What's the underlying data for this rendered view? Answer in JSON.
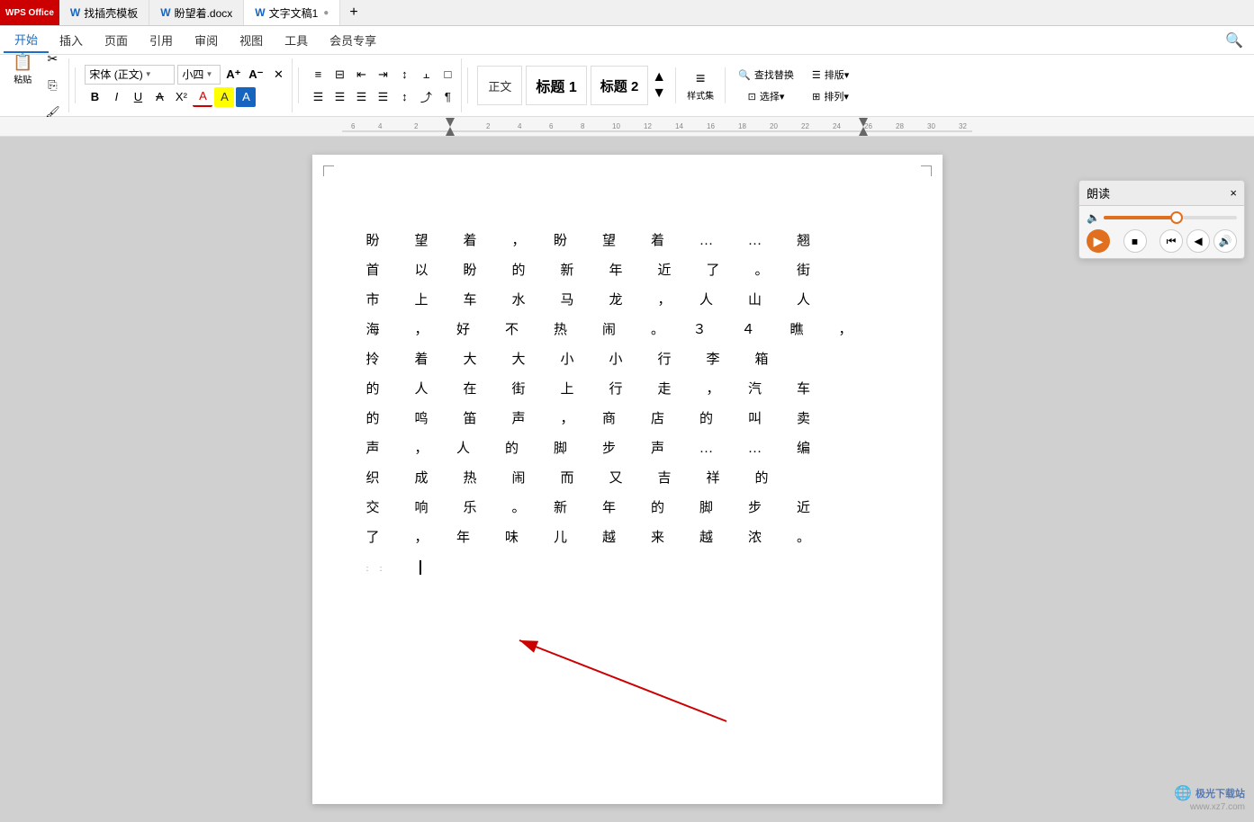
{
  "titlebar": {
    "logo": "WPS Office",
    "tabs": [
      {
        "label": "找插壳模板",
        "icon": "W",
        "active": false
      },
      {
        "label": "盼望着.docx",
        "icon": "W",
        "active": false
      },
      {
        "label": "文字文稿1",
        "icon": "W",
        "active": true
      }
    ],
    "new_tab": "+"
  },
  "ribbon": {
    "tabs": [
      {
        "label": "开始",
        "active": true
      },
      {
        "label": "插入",
        "active": false
      },
      {
        "label": "页面",
        "active": false
      },
      {
        "label": "引用",
        "active": false
      },
      {
        "label": "审阅",
        "active": false
      },
      {
        "label": "视图",
        "active": false
      },
      {
        "label": "工具",
        "active": false
      },
      {
        "label": "会员专享",
        "active": false
      }
    ],
    "font": {
      "name": "宋体 (正文)",
      "size": "小四"
    },
    "style_buttons": [
      {
        "label": "正文",
        "class": "zhengwen"
      },
      {
        "label": "标题 1",
        "class": "biaoti1"
      },
      {
        "label": "标题 2",
        "class": "biaoti2"
      }
    ],
    "right_buttons": [
      {
        "label": "样式集",
        "icon": "≡"
      },
      {
        "label": "查找替换",
        "icon": "🔍"
      },
      {
        "label": "选择▾",
        "icon": "⊡"
      },
      {
        "label": "排版▾",
        "icon": "☰"
      },
      {
        "label": "排列▾",
        "icon": "⊞"
      }
    ]
  },
  "doc": {
    "content_lines": [
      "盼　望　着　，　盼　望　着　…　…　翘",
      "首　以　盼　的　新　年　近　了　。　街",
      "市　上　车　水　马　龙　，　人　山　人",
      "海　，　好　不　热　闹　。　３　４　瞧　，",
      "拎　着　大　大　小　小　行　李　箱",
      "的　人　在　街　上　行　走　，　汽　车",
      "的　鸣　笛　声　，　商　店　的　叫　卖",
      "声　，　人　的　脚　步　声　…　…　编",
      "织　成　热　闹　而　又　吉　祥　的",
      "交　响　乐　。　新　年　的　脚　步　近",
      "了　，　年　味　儿　越　来　越　浓　。"
    ],
    "cursor_line": 11,
    "cursor_char": "|"
  },
  "reading_panel": {
    "title": "朗读",
    "close": "×",
    "slider_value": 55,
    "controls": [
      "◀",
      "▶",
      "⏪",
      "🔊"
    ]
  },
  "brand": {
    "name": "极光下载站",
    "url": "www.xz7.com"
  }
}
